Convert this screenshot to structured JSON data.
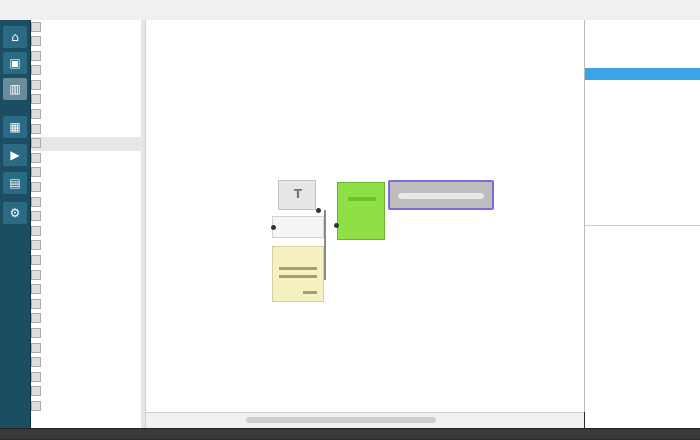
{
  "window": {
    "title": "",
    "menu": [
      "",
      "",
      "",
      "",
      "",
      "",
      ""
    ]
  },
  "launcher": {
    "buttons": [
      "home",
      "file",
      "image",
      "grid",
      "play",
      "layers",
      "settings"
    ]
  },
  "tree": {
    "items": [
      "",
      "",
      "",
      "",
      "",
      "",
      "",
      "",
      "",
      "",
      "",
      "",
      "",
      "",
      "",
      "",
      "",
      "",
      "",
      "",
      "",
      "",
      "",
      "",
      "",
      "",
      ""
    ],
    "selected_index": 8
  },
  "canvas": {
    "nodes": [
      {
        "name": "node-t",
        "label": ""
      },
      {
        "name": "node-mid",
        "label": ""
      },
      {
        "name": "node-yellow",
        "label": ""
      },
      {
        "name": "node-green",
        "label": ""
      },
      {
        "name": "node-gray",
        "label": ""
      }
    ]
  },
  "props": {
    "top_items": [
      "",
      "",
      "",
      "",
      "",
      "",
      ""
    ],
    "bottom_header": [
      "",
      ""
    ],
    "bottom_rows": [
      {
        "k": "",
        "v": ""
      },
      {
        "k": "",
        "v": ""
      },
      {
        "k": "",
        "v": ""
      },
      {
        "k": "",
        "v": ""
      },
      {
        "k": "",
        "v": ""
      },
      {
        "k": "",
        "v": ""
      },
      {
        "k": "",
        "v": ""
      },
      {
        "k": "",
        "v": ""
      },
      {
        "k": "",
        "v": ""
      },
      {
        "k": "",
        "v": ""
      },
      {
        "k": "",
        "v": ""
      },
      {
        "k": "",
        "v": ""
      },
      {
        "k": "",
        "v": ""
      },
      {
        "k": "",
        "v": ""
      },
      {
        "k": "",
        "v": ""
      }
    ]
  },
  "colors": {
    "launcher": "#1b4e63",
    "selection": "#3ba3e6",
    "green_node": "#8ee046",
    "yellow_node": "#f6f1c0",
    "gray_node_border": "#7a6ddf"
  }
}
